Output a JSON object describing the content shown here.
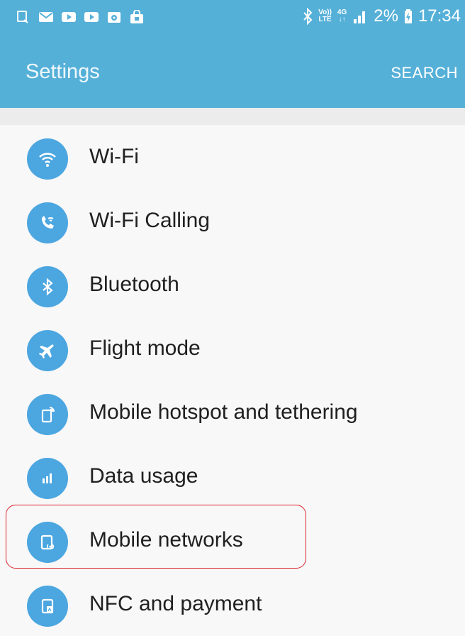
{
  "status_bar": {
    "battery_percent": "2%",
    "time": "17:34",
    "volte_top": "Vo))",
    "volte_bottom": "LTE",
    "network_type": "4G",
    "icons_left": [
      "screenshot-icon",
      "email-icon",
      "youtube-icon",
      "youtube-icon",
      "gallery-icon",
      "shopping-icon"
    ],
    "icons_right": [
      "bluetooth-icon",
      "volte-icon",
      "4g-icon",
      "signal-icon",
      "battery-charging-icon"
    ]
  },
  "app_bar": {
    "title": "Settings",
    "search_label": "SEARCH"
  },
  "settings_items": [
    {
      "label": "Wi-Fi",
      "icon": "wifi-icon"
    },
    {
      "label": "Wi-Fi Calling",
      "icon": "wifi-calling-icon"
    },
    {
      "label": "Bluetooth",
      "icon": "bluetooth-icon"
    },
    {
      "label": "Flight mode",
      "icon": "airplane-icon"
    },
    {
      "label": "Mobile hotspot and tethering",
      "icon": "hotspot-icon"
    },
    {
      "label": "Data usage",
      "icon": "data-usage-icon"
    },
    {
      "label": "Mobile networks",
      "icon": "mobile-networks-icon",
      "highlighted": true
    },
    {
      "label": "NFC and payment",
      "icon": "nfc-icon"
    }
  ],
  "colors": {
    "app_bar": "#55b0d8",
    "icon_circle": "#4ca6e0",
    "highlight": "#d9232d"
  }
}
